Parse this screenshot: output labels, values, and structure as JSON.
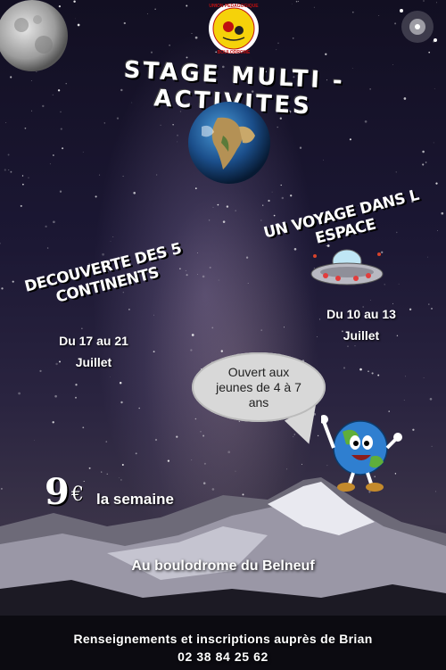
{
  "logo": {
    "text_top": "UNION PEDAGOGIQUE",
    "text_bottom": "BOULODROME"
  },
  "title": "STAGE MULTI - ACTIVITES",
  "left_theme": {
    "title": "DECOUVERTE DES 5 CONTINENTS",
    "dates_line1": "Du 17 au 21",
    "dates_line2": "Juillet"
  },
  "right_theme": {
    "title": "UN VOYAGE DANS L ESPACE",
    "dates_line1": "Du 10 au 13",
    "dates_line2": "Juillet"
  },
  "speech_bubble": {
    "line1": "Ouvert aux",
    "line2": "jeunes de 4 à 7",
    "line3": "ans"
  },
  "price": {
    "amount": "9",
    "currency": "€",
    "label": "la semaine"
  },
  "location": "Au boulodrome du Belneuf",
  "contact": {
    "label": "Renseignements et inscriptions auprès de Brian",
    "phone": "02 38 84 25 62"
  },
  "icons": [
    "moon-icon",
    "earth-icon",
    "ufo-icon",
    "earth-mascot-icon",
    "mountain-icon",
    "club-logo-icon"
  ],
  "colors": {
    "sky": "#120f22",
    "bubble": "#d8d8d8",
    "logo_yellow": "#f5d20a",
    "text": "#ffffff"
  }
}
